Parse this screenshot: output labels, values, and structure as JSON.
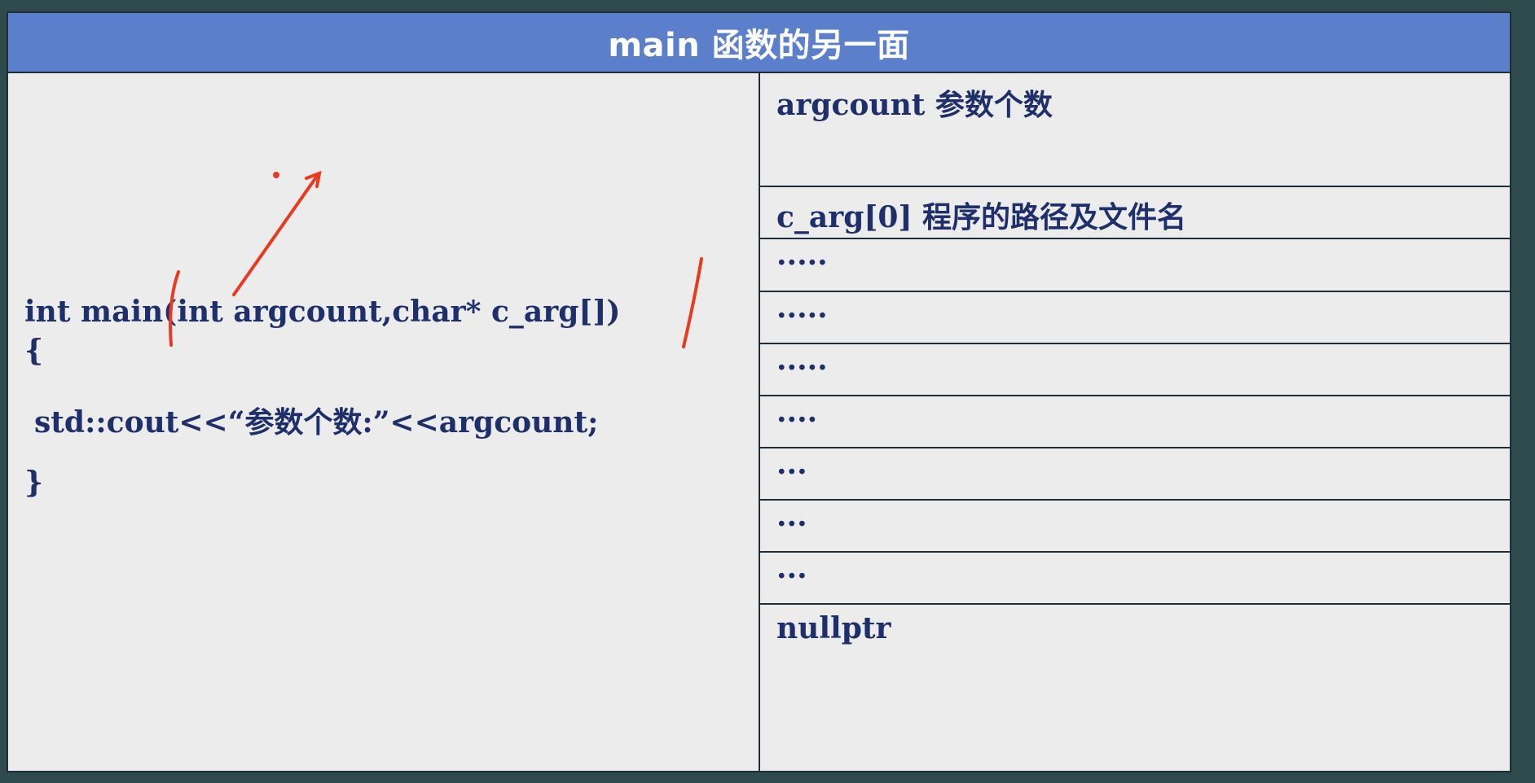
{
  "slide": {
    "title": "main 函数的另一面"
  },
  "code": {
    "line1": "int main(int argcount,char* c_arg[])",
    "line2": "{",
    "line3": "std::cout<<“参数个数:”<<argcount;",
    "line4": "}"
  },
  "table": {
    "rows": [
      "argcount 参数个数",
      "c_arg[0] 程序的路径及文件名",
      "·····",
      "·····",
      "·····",
      "····",
      "···",
      "···",
      "···",
      "nullptr"
    ]
  },
  "colors": {
    "title_bar": "#5b7fcb",
    "panel": "#ececec",
    "text": "#1f2f6a",
    "annotation": "#e83a1e",
    "background": "#2f4a4c"
  }
}
